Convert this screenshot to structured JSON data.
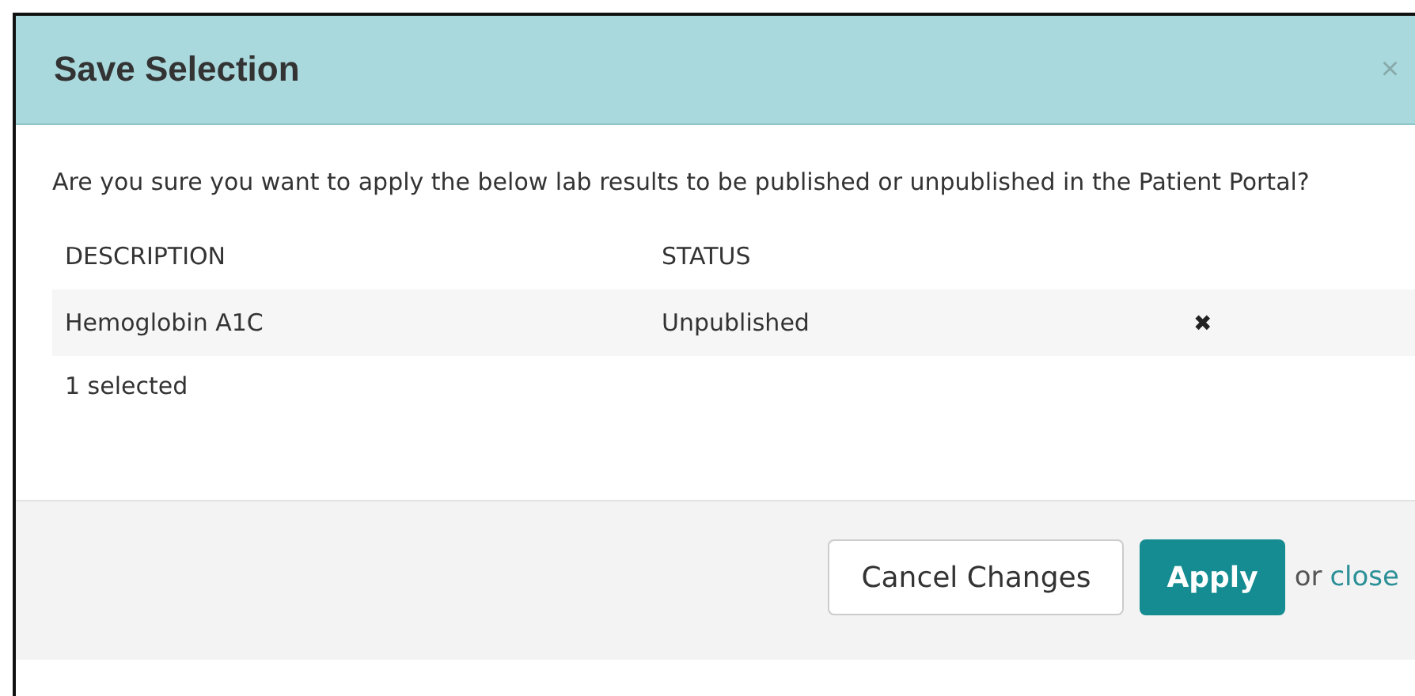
{
  "dialog": {
    "title": "Save Selection",
    "close_icon": "×"
  },
  "message": "Are you sure you want to apply the below lab results to be published or unpublished in the Patient Portal?",
  "table": {
    "columns": [
      "DESCRIPTION",
      "STATUS"
    ],
    "rows": [
      {
        "description": "Hemoglobin A1C",
        "status": "Unpublished",
        "remove": "✖"
      }
    ]
  },
  "selection_count": "1 selected",
  "footer": {
    "buttons": [
      {
        "label": "Cancel Changes",
        "kind": "secondary"
      },
      {
        "label": "Apply",
        "kind": "primary"
      }
    ],
    "or_text": "or",
    "close_link": "close"
  }
}
